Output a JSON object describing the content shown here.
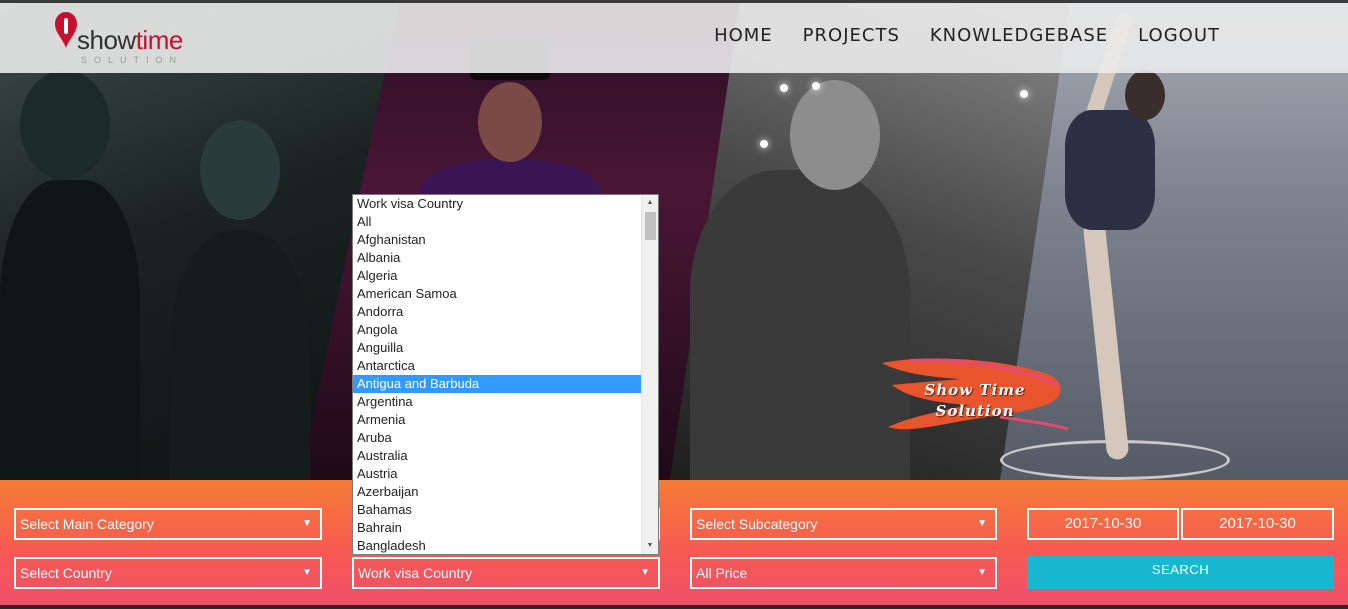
{
  "brand": {
    "word1": "show",
    "word2": "time",
    "subtitle": "SOLUTION"
  },
  "nav": {
    "items": [
      "HOME",
      "PROJECTS",
      "KNOWLEDGEBASE",
      "LOGOUT"
    ]
  },
  "hero": {
    "badge_line1": "Show Time",
    "badge_line2": "Solution"
  },
  "filters": {
    "main_category": "Select Main Category",
    "country": "Select Country",
    "work_visa_country": "Work visa Country",
    "subcategory": "Select Subcategory",
    "price": "All Price",
    "date_from": "2017-10-30",
    "date_to": "2017-10-30",
    "search_label": "SEARCH"
  },
  "dropdown": {
    "options": [
      "Work visa Country",
      "All",
      "Afghanistan",
      "Albania",
      "Algeria",
      "American Samoa",
      "Andorra",
      "Angola",
      "Anguilla",
      "Antarctica",
      "Antigua and Barbuda",
      "Argentina",
      "Armenia",
      "Aruba",
      "Australia",
      "Austria",
      "Azerbaijan",
      "Bahamas",
      "Bahrain",
      "Bangladesh"
    ],
    "highlighted": "Antigua and Barbuda"
  },
  "colors": {
    "brand_red": "#c8102e",
    "filter_top": "#f57c36",
    "filter_bottom": "#ef4e6b",
    "search_button": "#16b8cf",
    "highlight": "#3399ff"
  }
}
